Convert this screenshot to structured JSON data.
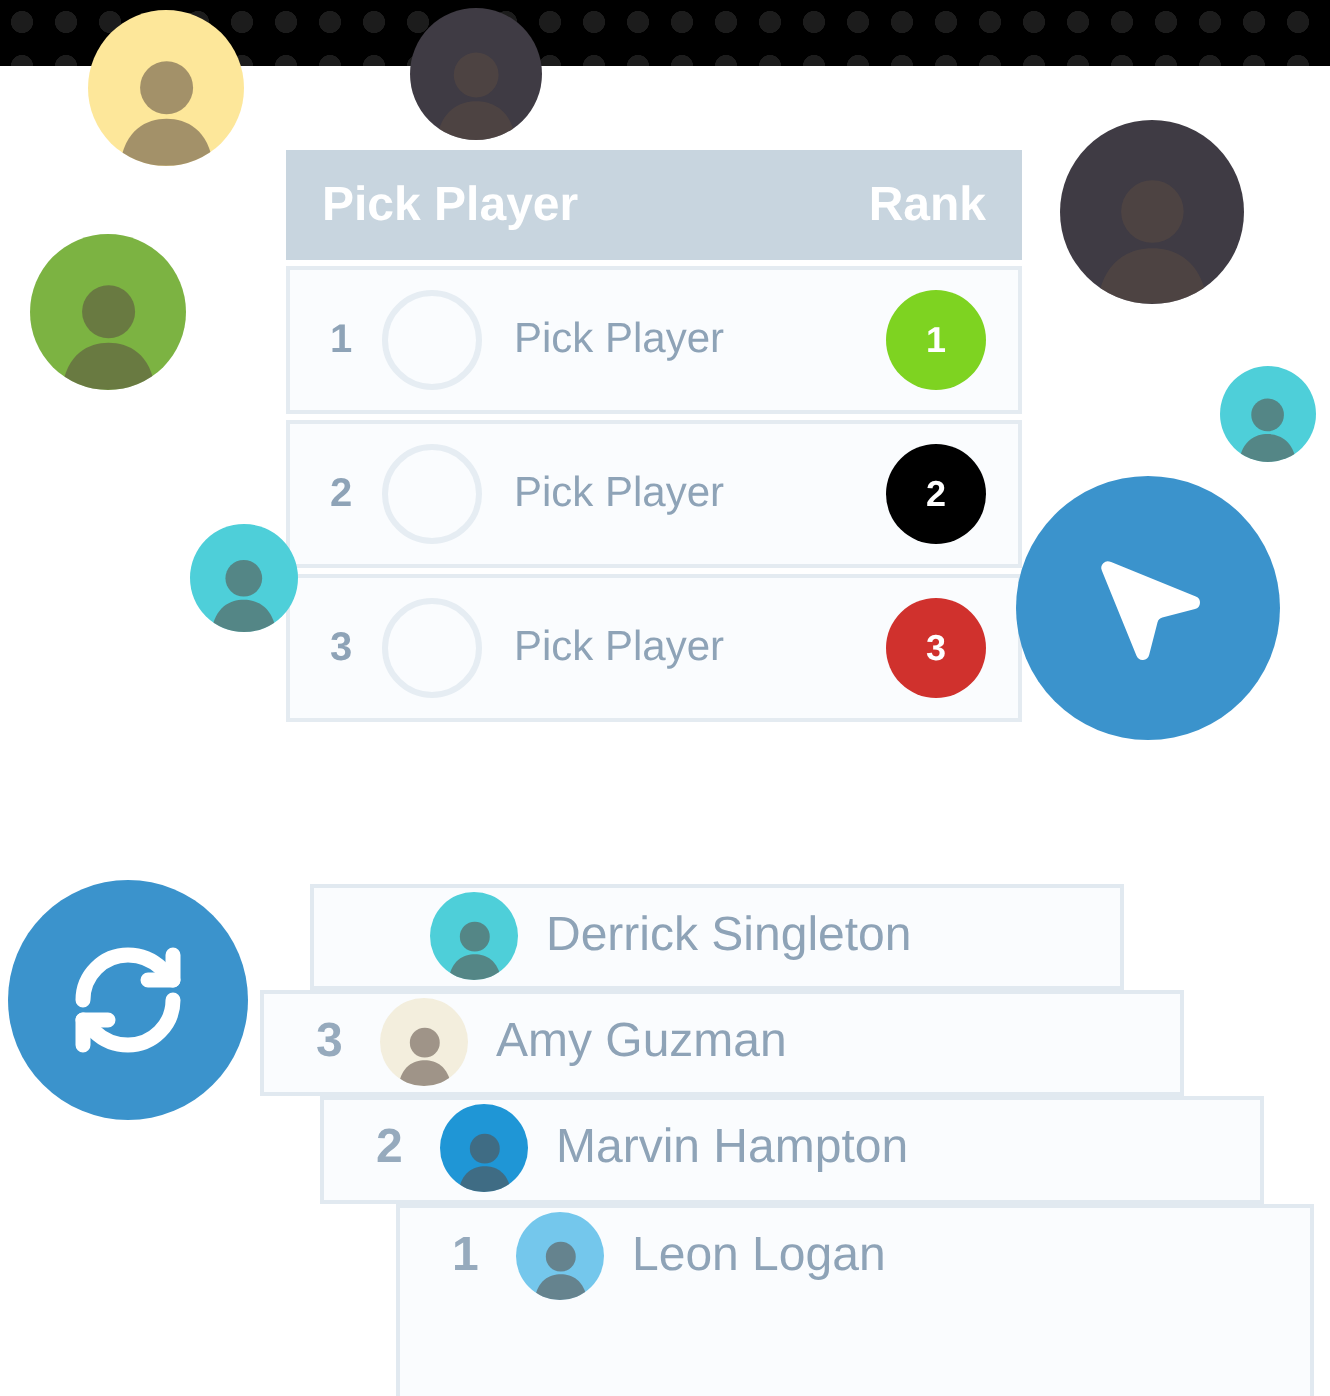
{
  "table": {
    "columns": [
      "Pick Player",
      "Rank"
    ],
    "rows": [
      {
        "number": "1",
        "label": "Pick Player",
        "rank": "1",
        "color": "#7ed321"
      },
      {
        "number": "2",
        "label": "Pick Player",
        "rank": "2",
        "color": "#000000"
      },
      {
        "number": "3",
        "label": "Pick Player",
        "rank": "3",
        "color": "#d0312d"
      }
    ]
  },
  "avatars": [
    {
      "color": "#fde79a"
    },
    {
      "color": "#3f3b44"
    },
    {
      "color": "#7cb342"
    },
    {
      "color": "#3f3b44"
    },
    {
      "color": "#4ecfd9"
    },
    {
      "color": "#4ecfd9"
    }
  ],
  "player_cards": [
    {
      "name": "Derrick Singleton",
      "color": "#4ecfd9"
    },
    {
      "rank": "3",
      "name": "Amy Guzman",
      "color": "#f3eedd"
    },
    {
      "rank": "2",
      "name": "Marvin Hampton",
      "color": "#1f96d6"
    },
    {
      "rank": "1",
      "name": "Leon Logan",
      "color": "#74c7ec"
    }
  ]
}
